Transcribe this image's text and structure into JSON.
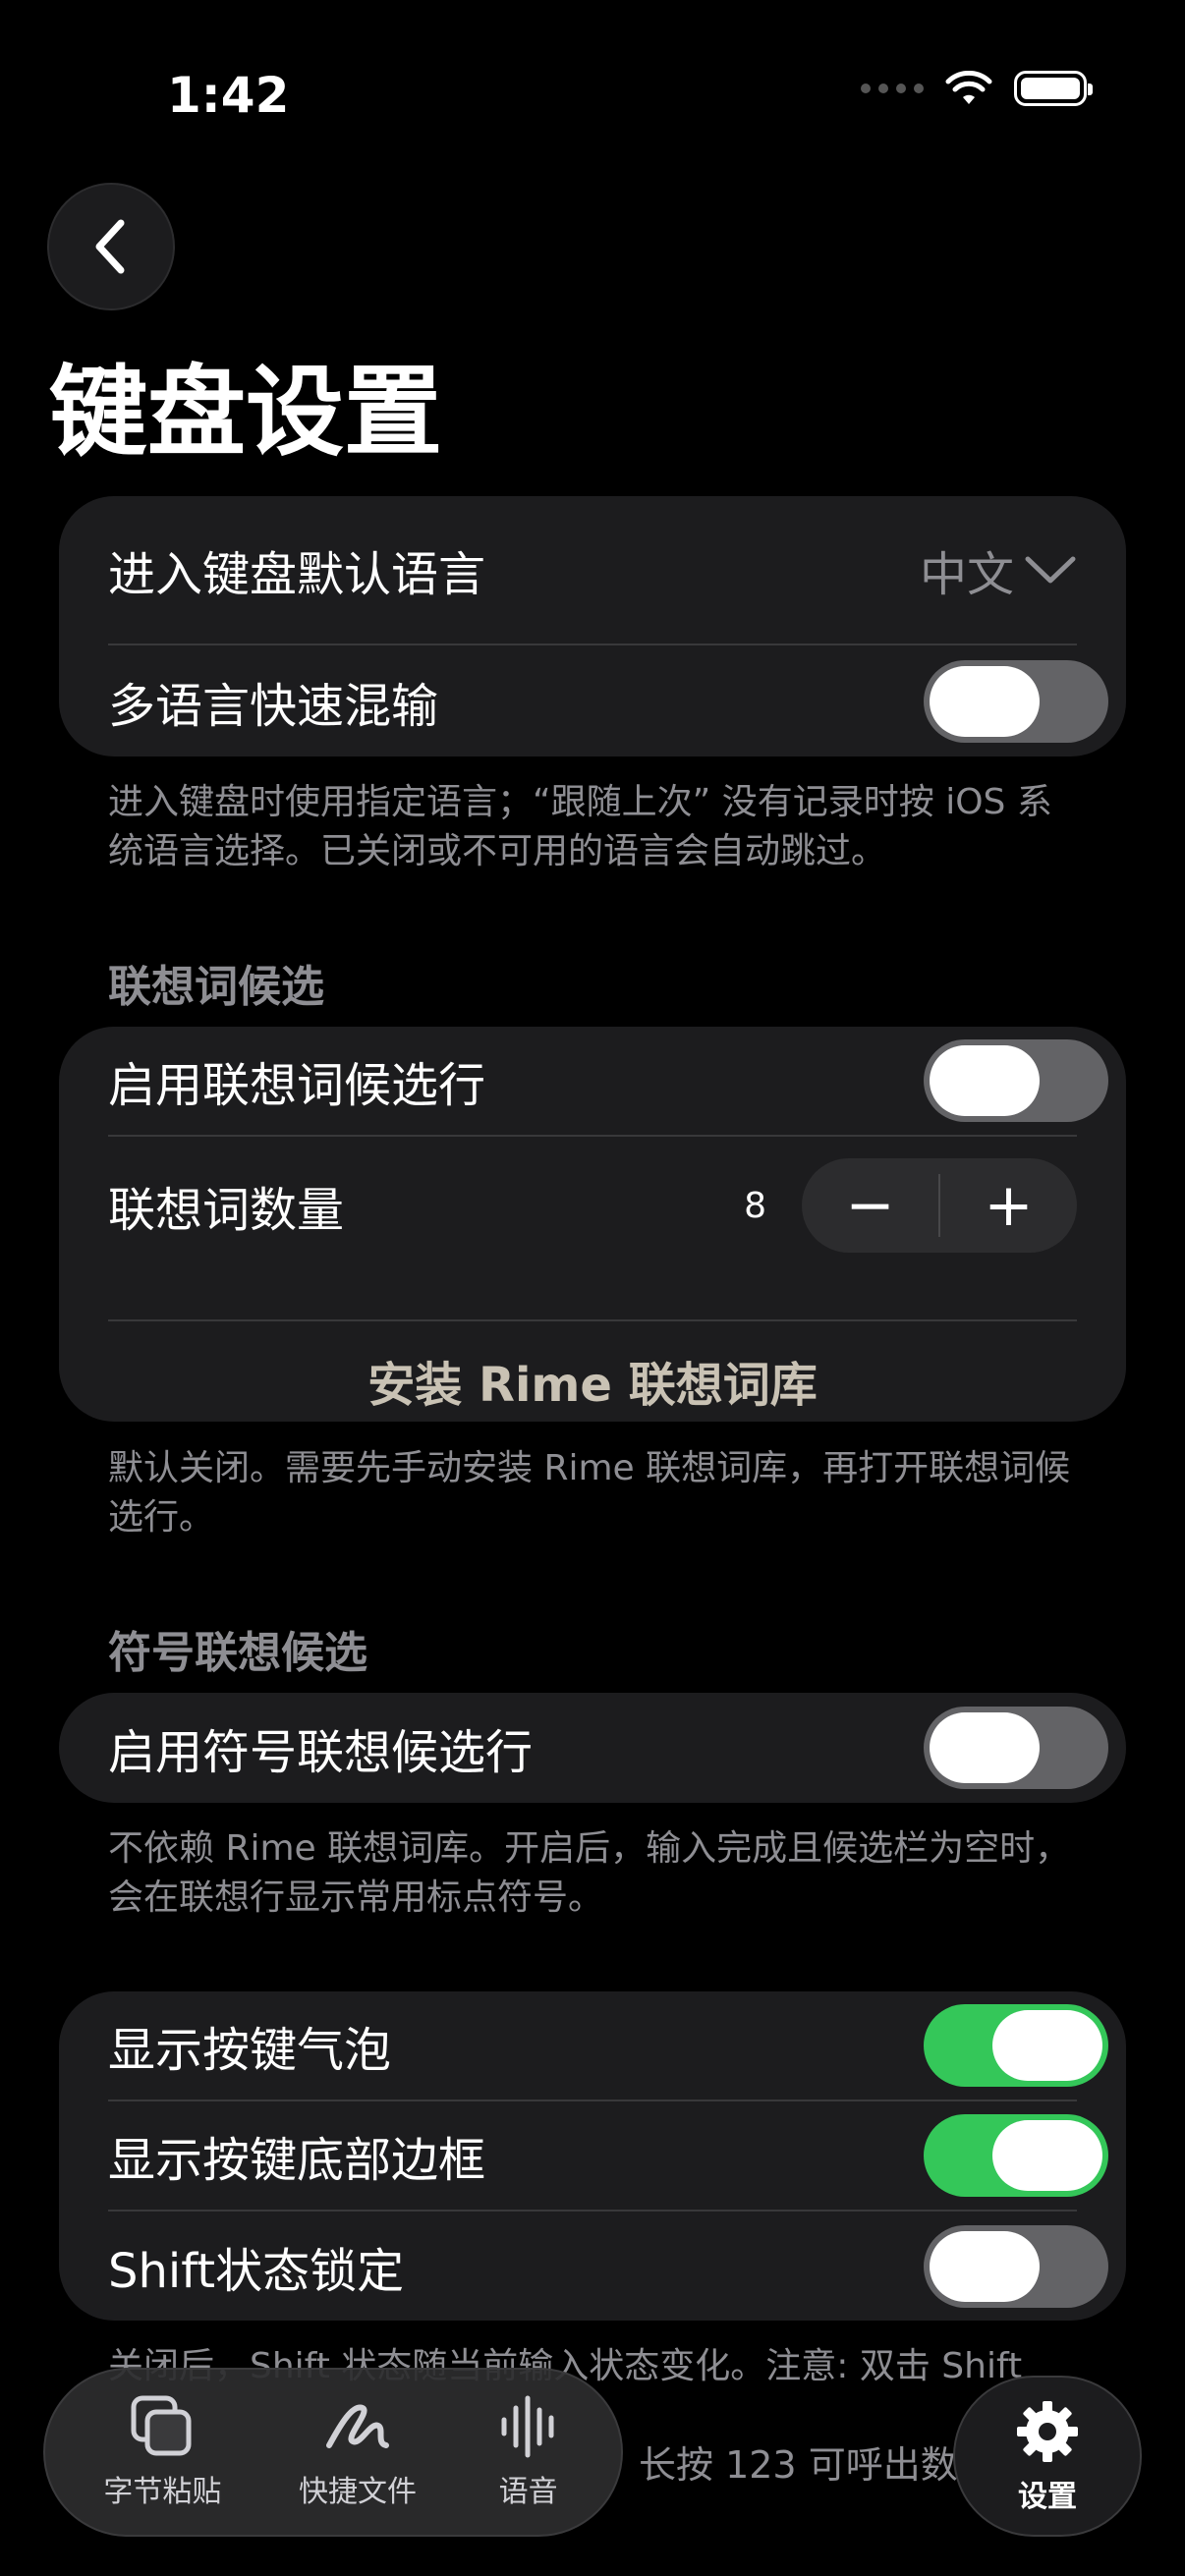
{
  "status": {
    "time": "1:42"
  },
  "nav": {
    "title": "键盘设置"
  },
  "language_card": {
    "default_language_label": "进入键盘默认语言",
    "default_language_value": "中文",
    "mixed_input_label": "多语言快速混输",
    "mixed_input_on": false
  },
  "language_footnote": "进入键盘时使用指定语言；“跟随上次” 没有记录时按 iOS 系统语言选择。已关闭或不可用的语言会自动跳过。",
  "prediction": {
    "header": "联想词候选",
    "enable_label": "启用联想词候选行",
    "enable_on": false,
    "count_label": "联想词数量",
    "count_value": "8",
    "minus": "−",
    "plus": "+",
    "install_link": "安装 Rime 联想词库",
    "footnote": "默认关闭。需要先手动安装 Rime 联想词库，再打开联想词候选行。"
  },
  "symbol": {
    "header": "符号联想候选",
    "enable_label": "启用符号联想候选行",
    "enable_on": false,
    "footnote": "不依赖 Rime 联想词库。开启后，输入完成且候选栏为空时，会在联想行显示常用标点符号。"
  },
  "keys": {
    "bubble_label": "显示按键气泡",
    "bubble_on": true,
    "border_label": "显示按键底部边框",
    "border_on": true,
    "shift_lock_label": "Shift状态锁定",
    "shift_lock_on": false,
    "footnote_partial": "关闭后，Shift 状态随当前输入状态变化。注意: 双击 Shift",
    "behind_text": "长按 123 可呼出数"
  },
  "tabbar": {
    "clipboard": "字节粘贴",
    "files": "快捷文件",
    "voice": "语音",
    "settings": "设置"
  },
  "colors": {
    "accent_green": "#34c759",
    "link_beige": "#c9c2b4",
    "card_bg": "#1c1c1e"
  }
}
